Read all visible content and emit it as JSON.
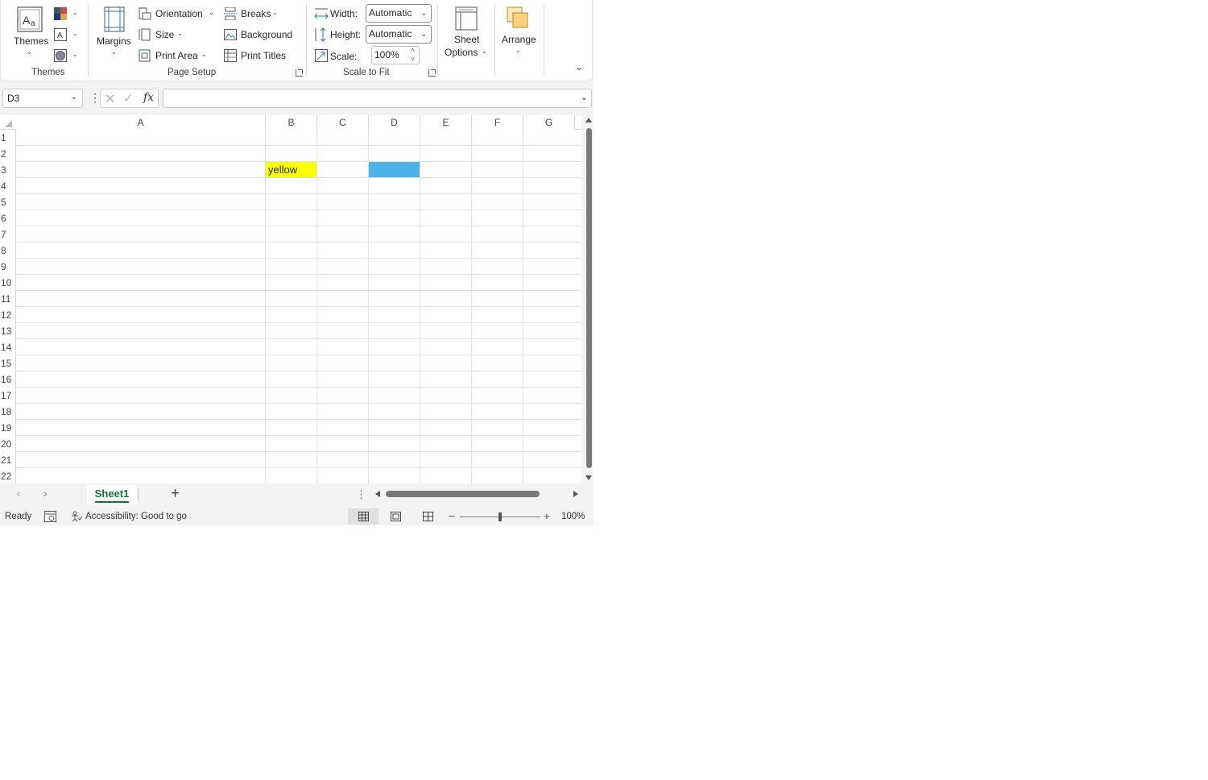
{
  "ribbon": {
    "themes": {
      "label": "Themes",
      "group_label": "Themes"
    },
    "page_setup": {
      "margins": "Margins",
      "orientation": "Orientation",
      "size": "Size",
      "print_area": "Print Area",
      "breaks": "Breaks",
      "background": "Background",
      "print_titles": "Print Titles",
      "group_label": "Page Setup"
    },
    "scale_to_fit": {
      "width_label": "Width:",
      "width_value": "Automatic",
      "height_label": "Height:",
      "height_value": "Automatic",
      "scale_label": "Scale:",
      "scale_value": "100%",
      "group_label": "Scale to Fit"
    },
    "sheet_options": {
      "line1": "Sheet",
      "line2": "Options"
    },
    "arrange": "Arrange"
  },
  "formula_bar": {
    "name_box": "D3",
    "fx": "fx",
    "value": ""
  },
  "grid": {
    "columns": [
      "A",
      "B",
      "C",
      "D",
      "E",
      "F",
      "G"
    ],
    "rows": [
      "1",
      "2",
      "3",
      "4",
      "5",
      "6",
      "7",
      "8",
      "9",
      "10",
      "11",
      "12",
      "13",
      "14",
      "15",
      "16",
      "17",
      "18",
      "19",
      "20",
      "21",
      "22"
    ],
    "cells": {
      "B3": {
        "value": "yellow",
        "fill": "#ffff00"
      },
      "D3": {
        "value": "",
        "fill": "#4db3e6"
      }
    },
    "selected_cell": "D3"
  },
  "sheets": {
    "tabs": [
      "Sheet1"
    ],
    "active": "Sheet1",
    "add": "+"
  },
  "status_bar": {
    "ready": "Ready",
    "accessibility": "Accessibility: Good to go",
    "zoom": "100%",
    "zoom_minus": "−",
    "zoom_plus": "+"
  },
  "colors": {
    "accent_green": "#1f6e43",
    "selection_fill": "#4db3e6",
    "yellow_fill": "#ffff00"
  }
}
